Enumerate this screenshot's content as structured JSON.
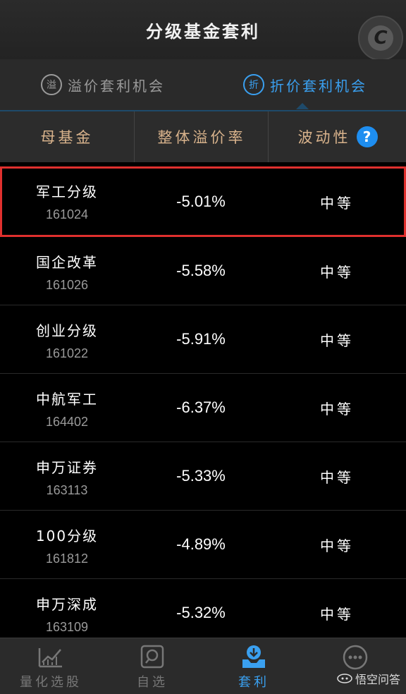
{
  "header": {
    "title": "分级基金套利"
  },
  "tabs": [
    {
      "label": "溢价套利机会",
      "icon": "溢",
      "active": false
    },
    {
      "label": "折价套利机会",
      "icon": "折",
      "active": true
    }
  ],
  "columns": {
    "name": "母基金",
    "rate": "整体溢价率",
    "volatility": "波动性",
    "help": "?"
  },
  "rows": [
    {
      "name": "军工分级",
      "code": "161024",
      "rate": "-5.01%",
      "volatility": "中等"
    },
    {
      "name": "国企改革",
      "code": "161026",
      "rate": "-5.58%",
      "volatility": "中等"
    },
    {
      "name": "创业分级",
      "code": "161022",
      "rate": "-5.91%",
      "volatility": "中等"
    },
    {
      "name": "中航军工",
      "code": "164402",
      "rate": "-6.37%",
      "volatility": "中等"
    },
    {
      "name": "申万证券",
      "code": "163113",
      "rate": "-5.33%",
      "volatility": "中等"
    },
    {
      "name": "100分级",
      "code": "161812",
      "rate": "-4.89%",
      "volatility": "中等"
    },
    {
      "name": "申万深成",
      "code": "163109",
      "rate": "-5.32%",
      "volatility": "中等"
    }
  ],
  "nav": [
    {
      "label": "量化选股",
      "icon": "chart-line-icon"
    },
    {
      "label": "自选",
      "icon": "search-square-icon"
    },
    {
      "label": "套利",
      "icon": "download-tray-icon",
      "active": true
    },
    {
      "label": "",
      "icon": "more-dots-icon"
    }
  ],
  "watermark": "悟空问答",
  "colors": {
    "accent": "#3aa0f0",
    "highlight": "#e0302e",
    "header_text": "#d9b38c"
  }
}
